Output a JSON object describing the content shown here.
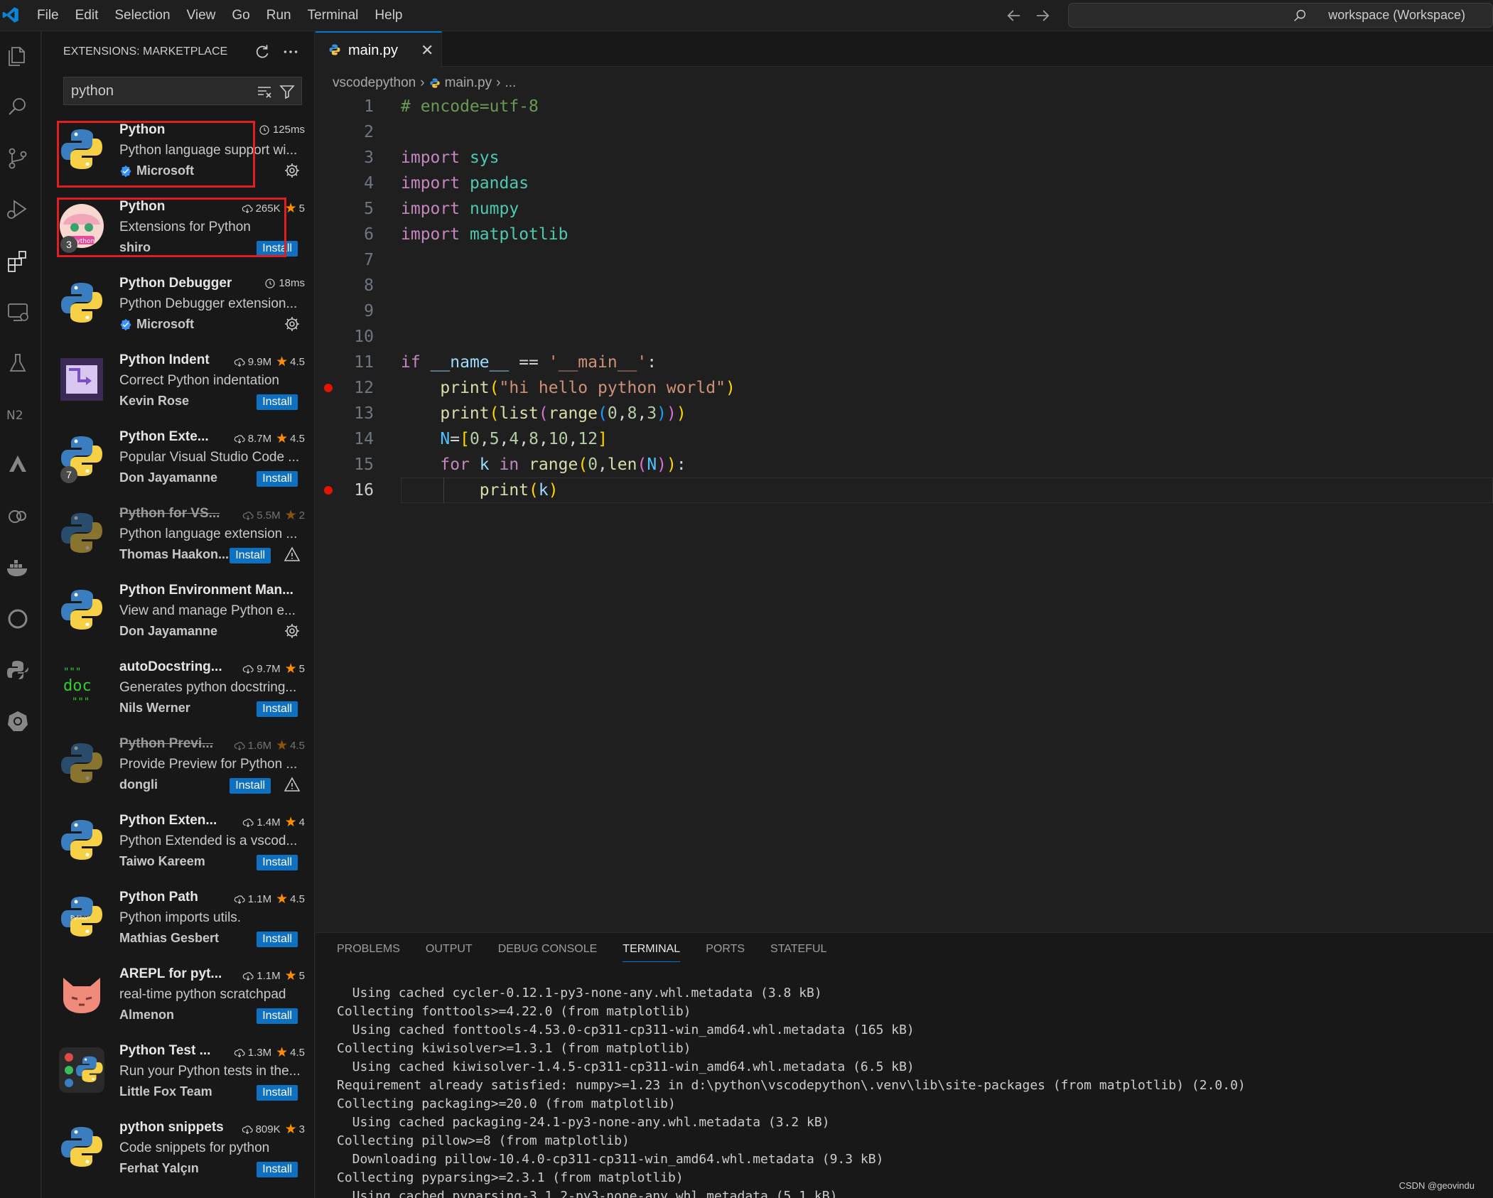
{
  "menu": [
    "File",
    "Edit",
    "Selection",
    "View",
    "Go",
    "Run",
    "Terminal",
    "Help"
  ],
  "command_center": "workspace (Workspace)",
  "sidebar": {
    "title": "EXTENSIONS: MARKETPLACE",
    "search_value": "python",
    "extensions": [
      {
        "name": "Python",
        "desc": "Python language support wi...",
        "publisher": "Microsoft",
        "verified": true,
        "stats": "125ms",
        "stat_kind": "time",
        "action": "gear",
        "highlighted": true
      },
      {
        "name": "Python",
        "desc": "Extensions for Python",
        "publisher": "shiro",
        "downloads": "265K",
        "rating": "5",
        "action": "Install",
        "badge": "3"
      },
      {
        "name": "Python Debugger",
        "desc": "Python Debugger extension...",
        "publisher": "Microsoft",
        "verified": true,
        "stats": "18ms",
        "stat_kind": "time",
        "action": "gear",
        "highlighted": true
      },
      {
        "name": "Python Indent",
        "desc": "Correct Python indentation",
        "publisher": "Kevin Rose",
        "downloads": "9.9M",
        "rating": "4.5",
        "action": "Install"
      },
      {
        "name": "Python Exte...",
        "desc": "Popular Visual Studio Code ...",
        "publisher": "Don Jayamanne",
        "downloads": "8.7M",
        "rating": "4.5",
        "action": "Install",
        "badge": "7"
      },
      {
        "name": "Python for VS...",
        "desc": "Python language extension ...",
        "publisher": "Thomas Haakon...",
        "downloads": "5.5M",
        "rating": "2",
        "action": "Install",
        "deprecated": true
      },
      {
        "name": "Python Environment Man...",
        "desc": "View and manage Python e...",
        "publisher": "Don Jayamanne",
        "action": "gear"
      },
      {
        "name": "autoDocstring...",
        "desc": "Generates python docstring...",
        "publisher": "Nils Werner",
        "downloads": "9.7M",
        "rating": "5",
        "action": "Install"
      },
      {
        "name": "Python Previ...",
        "desc": "Provide Preview for Python ...",
        "publisher": "dongli",
        "downloads": "1.6M",
        "rating": "4.5",
        "action": "Install",
        "deprecated": true
      },
      {
        "name": "Python Exten...",
        "desc": "Python Extended is a vscod...",
        "publisher": "Taiwo Kareem",
        "downloads": "1.4M",
        "rating": "4",
        "action": "Install"
      },
      {
        "name": "Python Path",
        "desc": "Python imports utils.",
        "publisher": "Mathias Gesbert",
        "downloads": "1.1M",
        "rating": "4.5",
        "action": "Install"
      },
      {
        "name": "AREPL for pyt...",
        "desc": "real-time python scratchpad",
        "publisher": "Almenon",
        "downloads": "1.1M",
        "rating": "5",
        "action": "Install"
      },
      {
        "name": "Python Test ...",
        "desc": "Run your Python tests in the...",
        "publisher": "Little Fox Team",
        "downloads": "1.3M",
        "rating": "4.5",
        "action": "Install"
      },
      {
        "name": "python snippets",
        "desc": "Code snippets for python",
        "publisher": "Ferhat Yalçın",
        "downloads": "809K",
        "rating": "3",
        "action": "Install"
      }
    ],
    "icon_names": [
      "python-logo-icon",
      "anime-python-icon",
      "python-logo-icon",
      "python-indent-icon",
      "python-logo-icon",
      "python-logo-icon",
      "python-logo-icon",
      "doc-icon",
      "python-logo-icon",
      "python-logo-icon",
      "python-path-icon",
      "arepl-cat-icon",
      "python-test-icon",
      "python-logo-icon"
    ]
  },
  "editor": {
    "tab_label": "main.py",
    "breadcrumb": [
      "vscodepython",
      "main.py",
      "..."
    ],
    "line_numbers": [
      "1",
      "2",
      "3",
      "4",
      "5",
      "6",
      "7",
      "8",
      "9",
      "10",
      "11",
      "12",
      "13",
      "14",
      "15",
      "16"
    ],
    "breakpoint_lines": [
      12,
      16
    ],
    "current_line": 16,
    "code": [
      "# encode=utf-8",
      "",
      "import sys",
      "import pandas",
      "import numpy",
      "import matplotlib",
      "",
      "",
      "",
      "",
      "if __name__ == '__main__':",
      "    print(\"hi hello python world\")",
      "    print(list(range(0,8,3)))",
      "    N=[0,5,4,8,10,12]",
      "    for k in range(0,len(N)):",
      "        print(k)"
    ]
  },
  "panel": {
    "tabs": [
      "PROBLEMS",
      "OUTPUT",
      "DEBUG CONSOLE",
      "TERMINAL",
      "PORTS",
      "STATEFUL"
    ],
    "active_tab": "TERMINAL",
    "terminal_lines": [
      "  Using cached cycler-0.12.1-py3-none-any.whl.metadata (3.8 kB)",
      "Collecting fonttools>=4.22.0 (from matplotlib)",
      "  Using cached fonttools-4.53.0-cp311-cp311-win_amd64.whl.metadata (165 kB)",
      "Collecting kiwisolver>=1.3.1 (from matplotlib)",
      "  Using cached kiwisolver-1.4.5-cp311-cp311-win_amd64.whl.metadata (6.5 kB)",
      "Requirement already satisfied: numpy>=1.23 in d:\\python\\vscodepython\\.venv\\lib\\site-packages (from matplotlib) (2.0.0)",
      "Collecting packaging>=20.0 (from matplotlib)",
      "  Using cached packaging-24.1-py3-none-any.whl.metadata (3.2 kB)",
      "Collecting pillow>=8 (from matplotlib)",
      "  Downloading pillow-10.4.0-cp311-cp311-win_amd64.whl.metadata (9.3 kB)",
      "Collecting pyparsing>=2.3.1 (from matplotlib)",
      "  Using cached pyparsing-3.1.2-py3-none-any.whl.metadata (5.1 kB)"
    ]
  },
  "watermark": "CSDN @geovindu",
  "colors": {
    "accent": "#0078d4",
    "install": "#0e70c0",
    "highlight_box": "#e02020",
    "star": "#ff8e00",
    "breakpoint": "#e51400"
  }
}
